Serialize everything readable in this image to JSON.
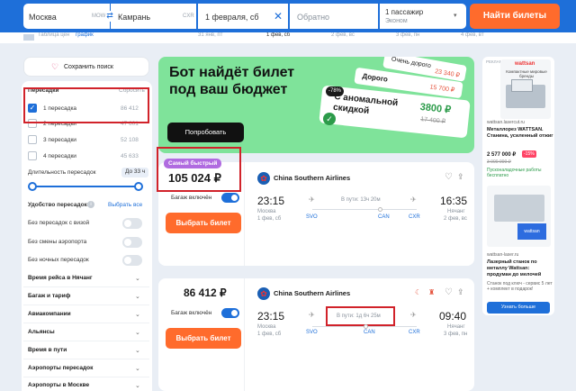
{
  "header": {
    "from_city": "Москва",
    "from_code": "MOW",
    "to_city": "Камрань",
    "to_code": "CXR",
    "date": "1 февраля, сб",
    "return_placeholder": "Обратно",
    "passengers": "1 пассажир",
    "cabin": "Эконом",
    "search_btn": "Найти билеты"
  },
  "date_strip": [
    "Таблица цен",
    "график",
    "31 янв, пт",
    "1 фев, сб",
    "2 фев, вс",
    "3 фев, пн",
    "4 фев, вт"
  ],
  "sidebar": {
    "save_search": "Сохранить поиск",
    "transfers_title": "Пересадки",
    "reset": "Сбросить",
    "transfers": [
      {
        "label": "1 пересадка",
        "price": "86 412",
        "checked": true
      },
      {
        "label": "2 пересадки",
        "price": "47 601",
        "checked": false
      },
      {
        "label": "3 пересадки",
        "price": "52 108",
        "checked": false
      },
      {
        "label": "4 пересадки",
        "price": "45 633",
        "checked": false
      }
    ],
    "duration_label": "Длительность пересадок",
    "duration_value": "До 33 ч",
    "convenience_title": "Удобство пересадок",
    "choose_all": "Выбрать все",
    "toggles": [
      "Без пересадок с визой",
      "Без смены аэропорта",
      "Без ночных пересадок"
    ],
    "accordions": [
      "Время рейса в Нячанг",
      "Багаж и тариф",
      "Авиакомпании",
      "Альянсы",
      "Время в пути",
      "Аэропорты пересадок",
      "Аэропорты в Москве"
    ]
  },
  "promo": {
    "title": "Бот найдёт билет под ваш бюджет",
    "button": "Попробовать",
    "tag_very_expensive": "Очень дорого",
    "price_very": "23 340 ₽",
    "tag_expensive": "Дорого",
    "price_exp": "15 700 ₽",
    "tag_anomal": "С аномальной скидкой",
    "discount": "-78%",
    "new_price": "3800 ₽",
    "old_price": "17 400 ₽"
  },
  "tickets": [
    {
      "badge": "Самый быстрый",
      "price": "105 024 ₽",
      "baggage": "Багаж включён",
      "select": "Выбрать билет",
      "airline": "China Southern Airlines",
      "dep_time": "23:15",
      "dep_city": "Москва",
      "dep_date": "1 фев, сб",
      "arr_time": "16:35",
      "arr_city": "Нячанг",
      "arr_date": "2 фев, вс",
      "duration": "В пути: 13ч 20м",
      "dep_code": "SVO",
      "via_code": "CAN",
      "arr_code": "CXR"
    },
    {
      "price": "86 412 ₽",
      "baggage": "Багаж включён",
      "select": "Выбрать билет",
      "airline": "China Southern Airlines",
      "dep_time": "23:15",
      "dep_city": "Москва",
      "dep_date": "1 фев, сб",
      "arr_time": "09:40",
      "arr_city": "Нячанг",
      "arr_date": "3 фев, пн",
      "duration": "В пути: 1д 6ч 25м",
      "dep_code": "SVO",
      "via_code": "CAN",
      "arr_code": "CXR"
    }
  ],
  "ads": {
    "label": "РЕКЛАМА",
    "banner_top": "Компактные мировые бренды",
    "brand": "wattsan",
    "domain1": "wattsan.lasercut.ru",
    "title1": "Металлорез WATTSAN. Станина, усиленный отжиг",
    "price1": "2 577 000 ₽",
    "old1": "3 000 000 ₽",
    "disc1": "-15%",
    "note1": "Пусконаладочные работы бесплатно",
    "domain2": "wattsan-laser.ru",
    "title2": "Лазерный станок по металлу Wattsan: продуман до мелочей",
    "desc2": "Станок под ключ - сервис 5 лет + комплект в подарок!",
    "learn": "Узнать больше"
  }
}
